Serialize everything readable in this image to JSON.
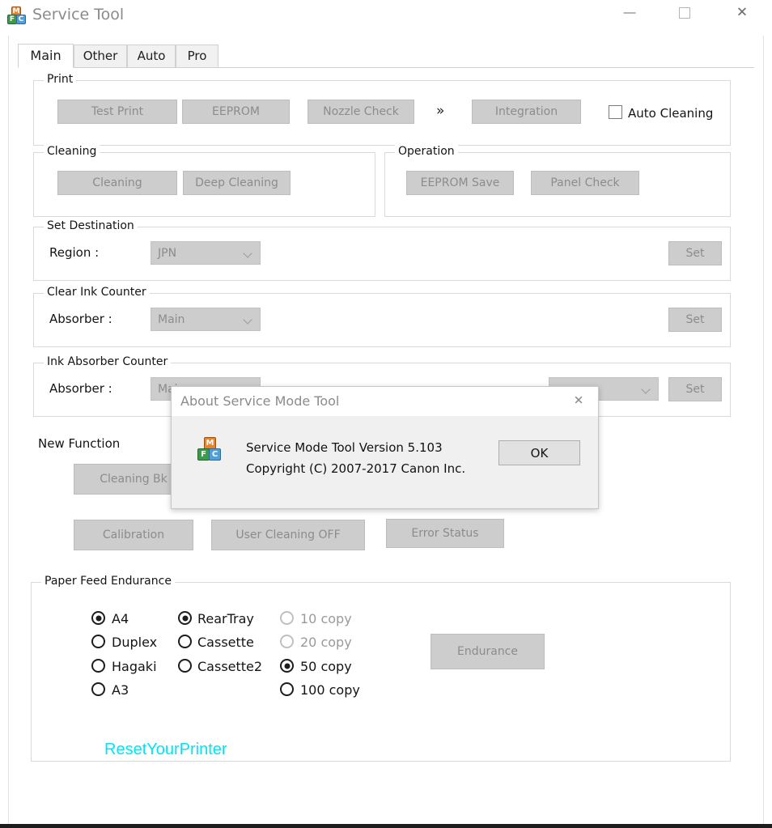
{
  "window": {
    "title": "Service Tool",
    "icon": "app-blocks-icon",
    "icon_letters": {
      "top": "M",
      "left": "F",
      "right": "C"
    },
    "controls": {
      "minimize": "minimize-icon",
      "maximize": "maximize-icon",
      "close": "close-icon",
      "close_glyph": "✕"
    }
  },
  "tabs": [
    {
      "label": "Main",
      "active": true
    },
    {
      "label": "Other",
      "active": false
    },
    {
      "label": "Auto",
      "active": false
    },
    {
      "label": "Pro",
      "active": false
    }
  ],
  "groups": {
    "print": {
      "title": "Print",
      "buttons": [
        "Test Print",
        "EEPROM",
        "Nozzle Check",
        "Integration"
      ],
      "chevron": "»",
      "checkbox": {
        "label": "Auto Cleaning",
        "checked": false
      }
    },
    "cleaning": {
      "title": "Cleaning",
      "buttons": [
        "Cleaning",
        "Deep Cleaning"
      ]
    },
    "operation": {
      "title": "Operation",
      "buttons": [
        "EEPROM Save",
        "Panel Check"
      ]
    },
    "set_destination": {
      "title": "Set Destination",
      "field_label": "Region :",
      "combo_value": "JPN",
      "set_button": "Set"
    },
    "clear_ink_counter": {
      "title": "Clear Ink Counter",
      "field_label": "Absorber :",
      "combo_value": "Main",
      "set_button": "Set"
    },
    "ink_absorber_counter": {
      "title": "Ink Absorber Counter",
      "field_label": "Absorber :",
      "combo_value": "Main",
      "combo2_value": "",
      "set_button": "Set"
    },
    "new_function": {
      "title": "New Function",
      "buttons": [
        "Cleaning Bk",
        "Calibration",
        "User Cleaning OFF",
        "Error Status"
      ]
    },
    "paper_feed_endurance": {
      "title": "Paper Feed Endurance",
      "paper_options": [
        {
          "label": "A4",
          "selected": true,
          "enabled": true
        },
        {
          "label": "Duplex",
          "selected": false,
          "enabled": true
        },
        {
          "label": "Hagaki",
          "selected": false,
          "enabled": true
        },
        {
          "label": "A3",
          "selected": false,
          "enabled": true
        }
      ],
      "source_options": [
        {
          "label": "RearTray",
          "selected": true,
          "enabled": true
        },
        {
          "label": "Cassette",
          "selected": false,
          "enabled": true
        },
        {
          "label": "Cassette2",
          "selected": false,
          "enabled": true
        }
      ],
      "copy_options": [
        {
          "label": "10 copy",
          "selected": false,
          "enabled": false
        },
        {
          "label": "20 copy",
          "selected": false,
          "enabled": false
        },
        {
          "label": "50 copy",
          "selected": true,
          "enabled": true
        },
        {
          "label": "100 copy",
          "selected": false,
          "enabled": true
        }
      ],
      "action_button": "Endurance"
    }
  },
  "link": {
    "label": "ResetYourPrinter",
    "color": "#00e5f6"
  },
  "dialog": {
    "title": "About Service Mode Tool",
    "close_glyph": "✕",
    "icon": "app-blocks-icon",
    "icon_letters": {
      "top": "M",
      "left": "F",
      "right": "C"
    },
    "line1": "Service Mode Tool  Version 5.103",
    "line2": "Copyright (C) 2007-2017 Canon Inc.",
    "ok_button": "OK"
  }
}
